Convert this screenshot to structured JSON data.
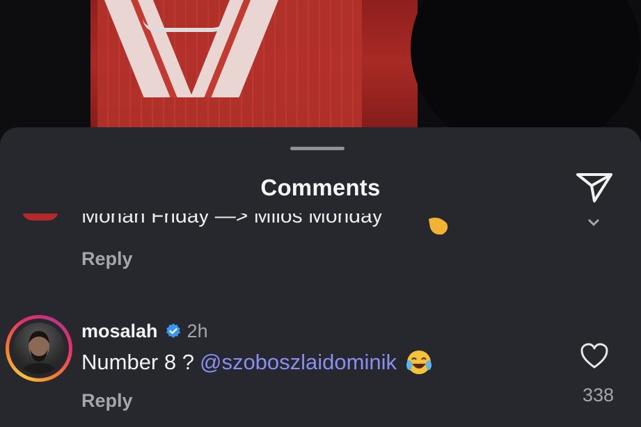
{
  "sheet": {
    "title": "Comments",
    "share_icon": "paper-plane-icon"
  },
  "previous_comment": {
    "text": "Mohan Friday —> Milos Monday",
    "emoji": "clapping-hand-emoji",
    "reply_label": "Reply"
  },
  "comment": {
    "username": "mosalah",
    "verified": true,
    "time": "2h",
    "text": "Number 8 ?",
    "mention": "@szoboszlaidominik",
    "emoji": "laughing-tears-emoji",
    "reply_label": "Reply",
    "like_count": "338"
  },
  "colors": {
    "sheet_bg": "#26282e",
    "mention": "#8a8ef0",
    "verified_blue": "#3797f0"
  }
}
